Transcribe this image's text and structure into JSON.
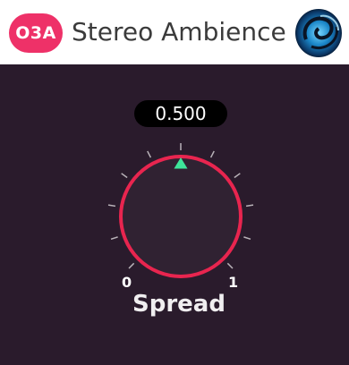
{
  "header": {
    "badge": "O3A",
    "title": "Stereo Ambience",
    "badge_color": "#ee3168",
    "logo_icon": "swirl-logo-icon"
  },
  "knob": {
    "label": "Spread",
    "value_text": "0.500",
    "value": 0.5,
    "min_label": "0",
    "max_label": "1",
    "ring_color": "#e8254f",
    "indicator_color": "#3ee59a"
  }
}
